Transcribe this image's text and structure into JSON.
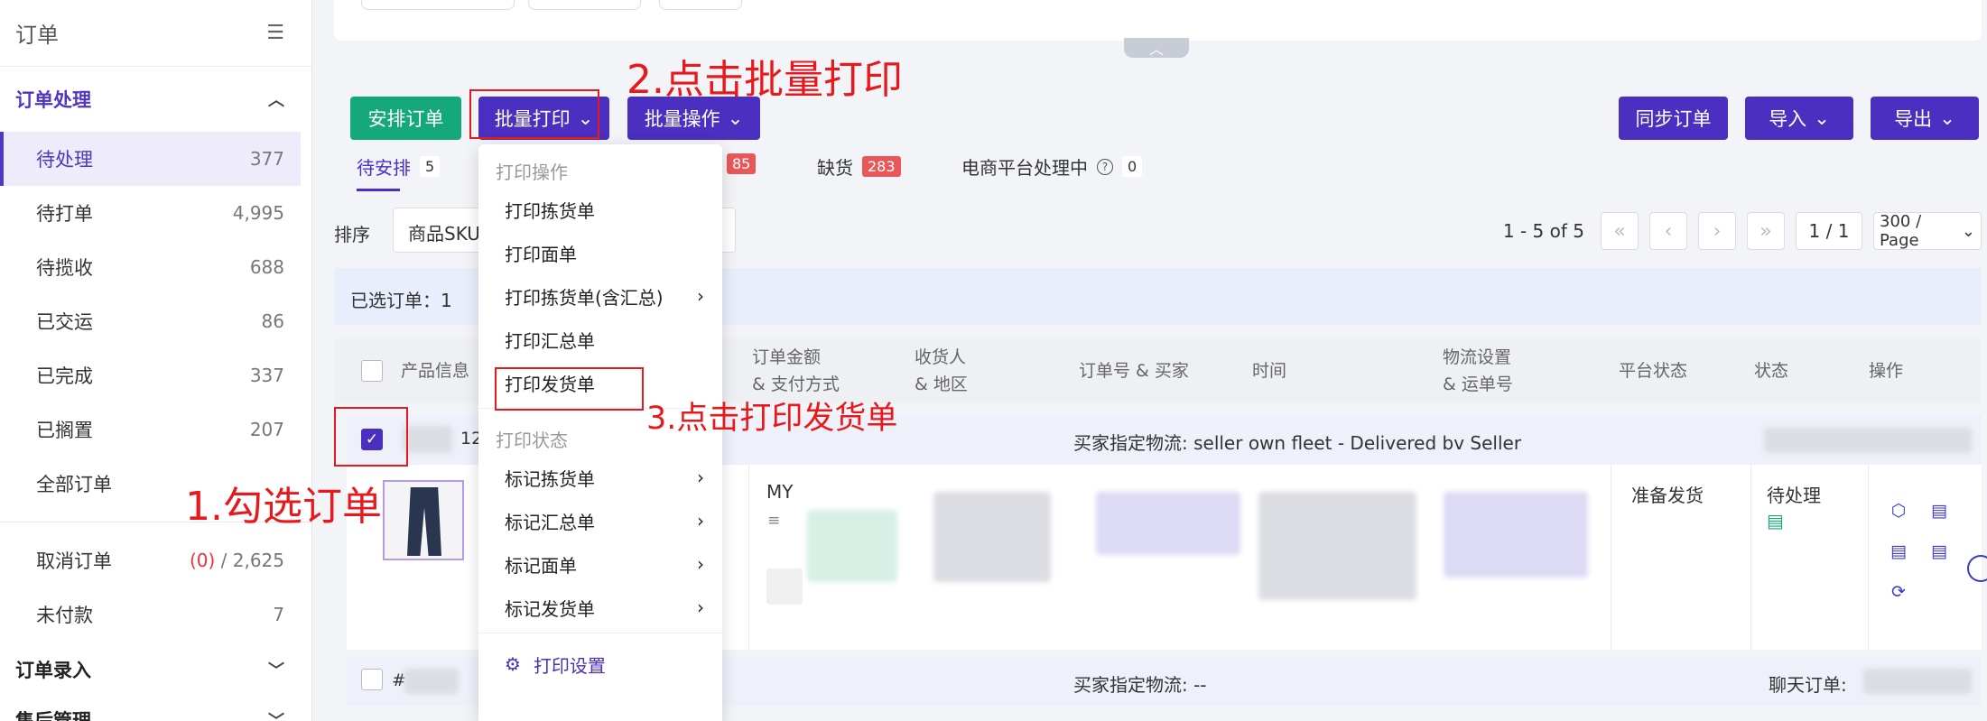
{
  "sidebar": {
    "title": "订单",
    "sections": [
      {
        "label": "订单处理"
      },
      {
        "label": "订单录入"
      },
      {
        "label": "售后管理"
      }
    ],
    "items": [
      {
        "label": "待处理",
        "count": "377"
      },
      {
        "label": "待打单",
        "count": "4,995"
      },
      {
        "label": "待揽收",
        "count": "688"
      },
      {
        "label": "已交运",
        "count": "86"
      },
      {
        "label": "已完成",
        "count": "337"
      },
      {
        "label": "已搁置",
        "count": "207"
      },
      {
        "label": "全部订单",
        "count": ""
      },
      {
        "label": "取消订单",
        "count_red": "(0)",
        "count": "/ 2,625"
      },
      {
        "label": "未付款",
        "count": "7"
      }
    ]
  },
  "toolbar": {
    "arrange": "安排订单",
    "batch_print": "批量打印",
    "batch_ops": "批量操作",
    "sync": "同步订单",
    "import": "导入",
    "export": "导出"
  },
  "tabs": [
    {
      "label": "待安排",
      "count": "5"
    },
    {
      "label": "",
      "count": "85"
    },
    {
      "label": "缺货",
      "count": "283"
    },
    {
      "label": "电商平台处理中",
      "count": "0"
    }
  ],
  "sort": {
    "label": "排序",
    "value": "商品SKU"
  },
  "pager": {
    "range": "1 - 5 of 5",
    "page": "1 / 1",
    "size": "300 / Page"
  },
  "selection": {
    "text": "已选订单：1"
  },
  "table": {
    "headers": [
      {
        "l1": "产品信息",
        "l2": ""
      },
      {
        "l1": "订单金额",
        "l2": "& 支付方式"
      },
      {
        "l1": "收货人",
        "l2": "& 地区"
      },
      {
        "l1": "订单号 & 买家",
        "l2": ""
      },
      {
        "l1": "时间",
        "l2": ""
      },
      {
        "l1": "物流设置",
        "l2": "& 运单号"
      },
      {
        "l1": "平台状态",
        "l2": ""
      },
      {
        "l1": "状态",
        "l2": ""
      },
      {
        "l1": "操作",
        "l2": ""
      }
    ]
  },
  "order1": {
    "id_frag": "12",
    "logistics": "买家指定物流: seller  own  fleet - Delivered bv Seller",
    "amount_frag": "MY",
    "platform_status": "准备发货",
    "status": "待处理"
  },
  "order2": {
    "id_frag": "#",
    "logistics": "买家指定物流: --",
    "chat": "聊天订单:"
  },
  "dropdown": {
    "group1": "打印操作",
    "items1": [
      {
        "label": "打印拣货单"
      },
      {
        "label": "打印面单"
      },
      {
        "label": "打印拣货单(含汇总)",
        "arrow": "›"
      },
      {
        "label": "打印汇总单"
      },
      {
        "label": "打印发货单"
      }
    ],
    "group2": "打印状态",
    "items2": [
      {
        "label": "标记拣货单",
        "arrow": "›"
      },
      {
        "label": "标记汇总单",
        "arrow": "›"
      },
      {
        "label": "标记面单",
        "arrow": "›"
      },
      {
        "label": "标记发货单",
        "arrow": "›"
      }
    ],
    "settings": "打印设置"
  },
  "annotations": {
    "step1": "1.勾选订单",
    "step2": "2.点击批量打印",
    "step3": "3.点击打印发货单",
    "color": "#e8191c"
  },
  "colors": {
    "primary": "#4a2fc0",
    "green": "#15a97a",
    "badge_red": "#e8585a"
  }
}
